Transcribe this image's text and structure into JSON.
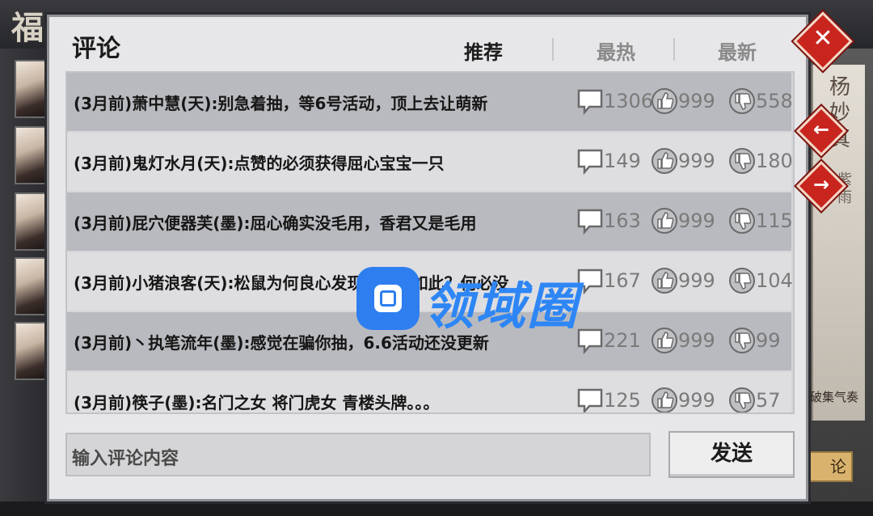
{
  "background": {
    "game_title_char": "福",
    "side_card": {
      "name": "杨妙真",
      "sub": "紫雨",
      "text": "破集气奏",
      "button": "论"
    }
  },
  "dialog": {
    "title": "评论",
    "tabs": [
      {
        "label": "推荐",
        "active": true
      },
      {
        "label": "最热",
        "active": false
      },
      {
        "label": "最新",
        "active": false
      }
    ],
    "comments": [
      {
        "text": "(3月前)萧中慧(天):别急着抽，等6号活动，顶上去让萌新",
        "replies": "1306",
        "likes": "999",
        "dislikes": "558"
      },
      {
        "text": "(3月前)鬼灯水月(天):点赞的必须获得屈心宝宝一只",
        "replies": "149",
        "likes": "999",
        "dislikes": "180"
      },
      {
        "text": "(3月前)屁穴便器芙(墨):屈心确实没毛用，香君又是毛用",
        "replies": "163",
        "likes": "999",
        "dislikes": "115"
      },
      {
        "text": "(3月前)小猪浪客(天):松鼠为何良心发现？何必如此？何必没",
        "replies": "167",
        "likes": "999",
        "dislikes": "104"
      },
      {
        "text": "(3月前)丶执笔流年(墨):感觉在骗你抽，6.6活动还没更新",
        "replies": "221",
        "likes": "999",
        "dislikes": "99"
      },
      {
        "text": "(3月前)筷子(墨):名门之女 将门虎女 青楼头牌。。。",
        "replies": "125",
        "likes": "999",
        "dislikes": "57"
      }
    ],
    "input_placeholder": "输入评论内容",
    "send_label": "发送"
  },
  "side_buttons": {
    "close": "✕",
    "prev": "←",
    "next": "→"
  },
  "watermark": {
    "text": "领域圈"
  },
  "colors": {
    "accent_red": "#c9251f",
    "watermark_blue": "#2e7ef0",
    "row_dark": "#b9babf",
    "row_light": "#dedee1"
  }
}
